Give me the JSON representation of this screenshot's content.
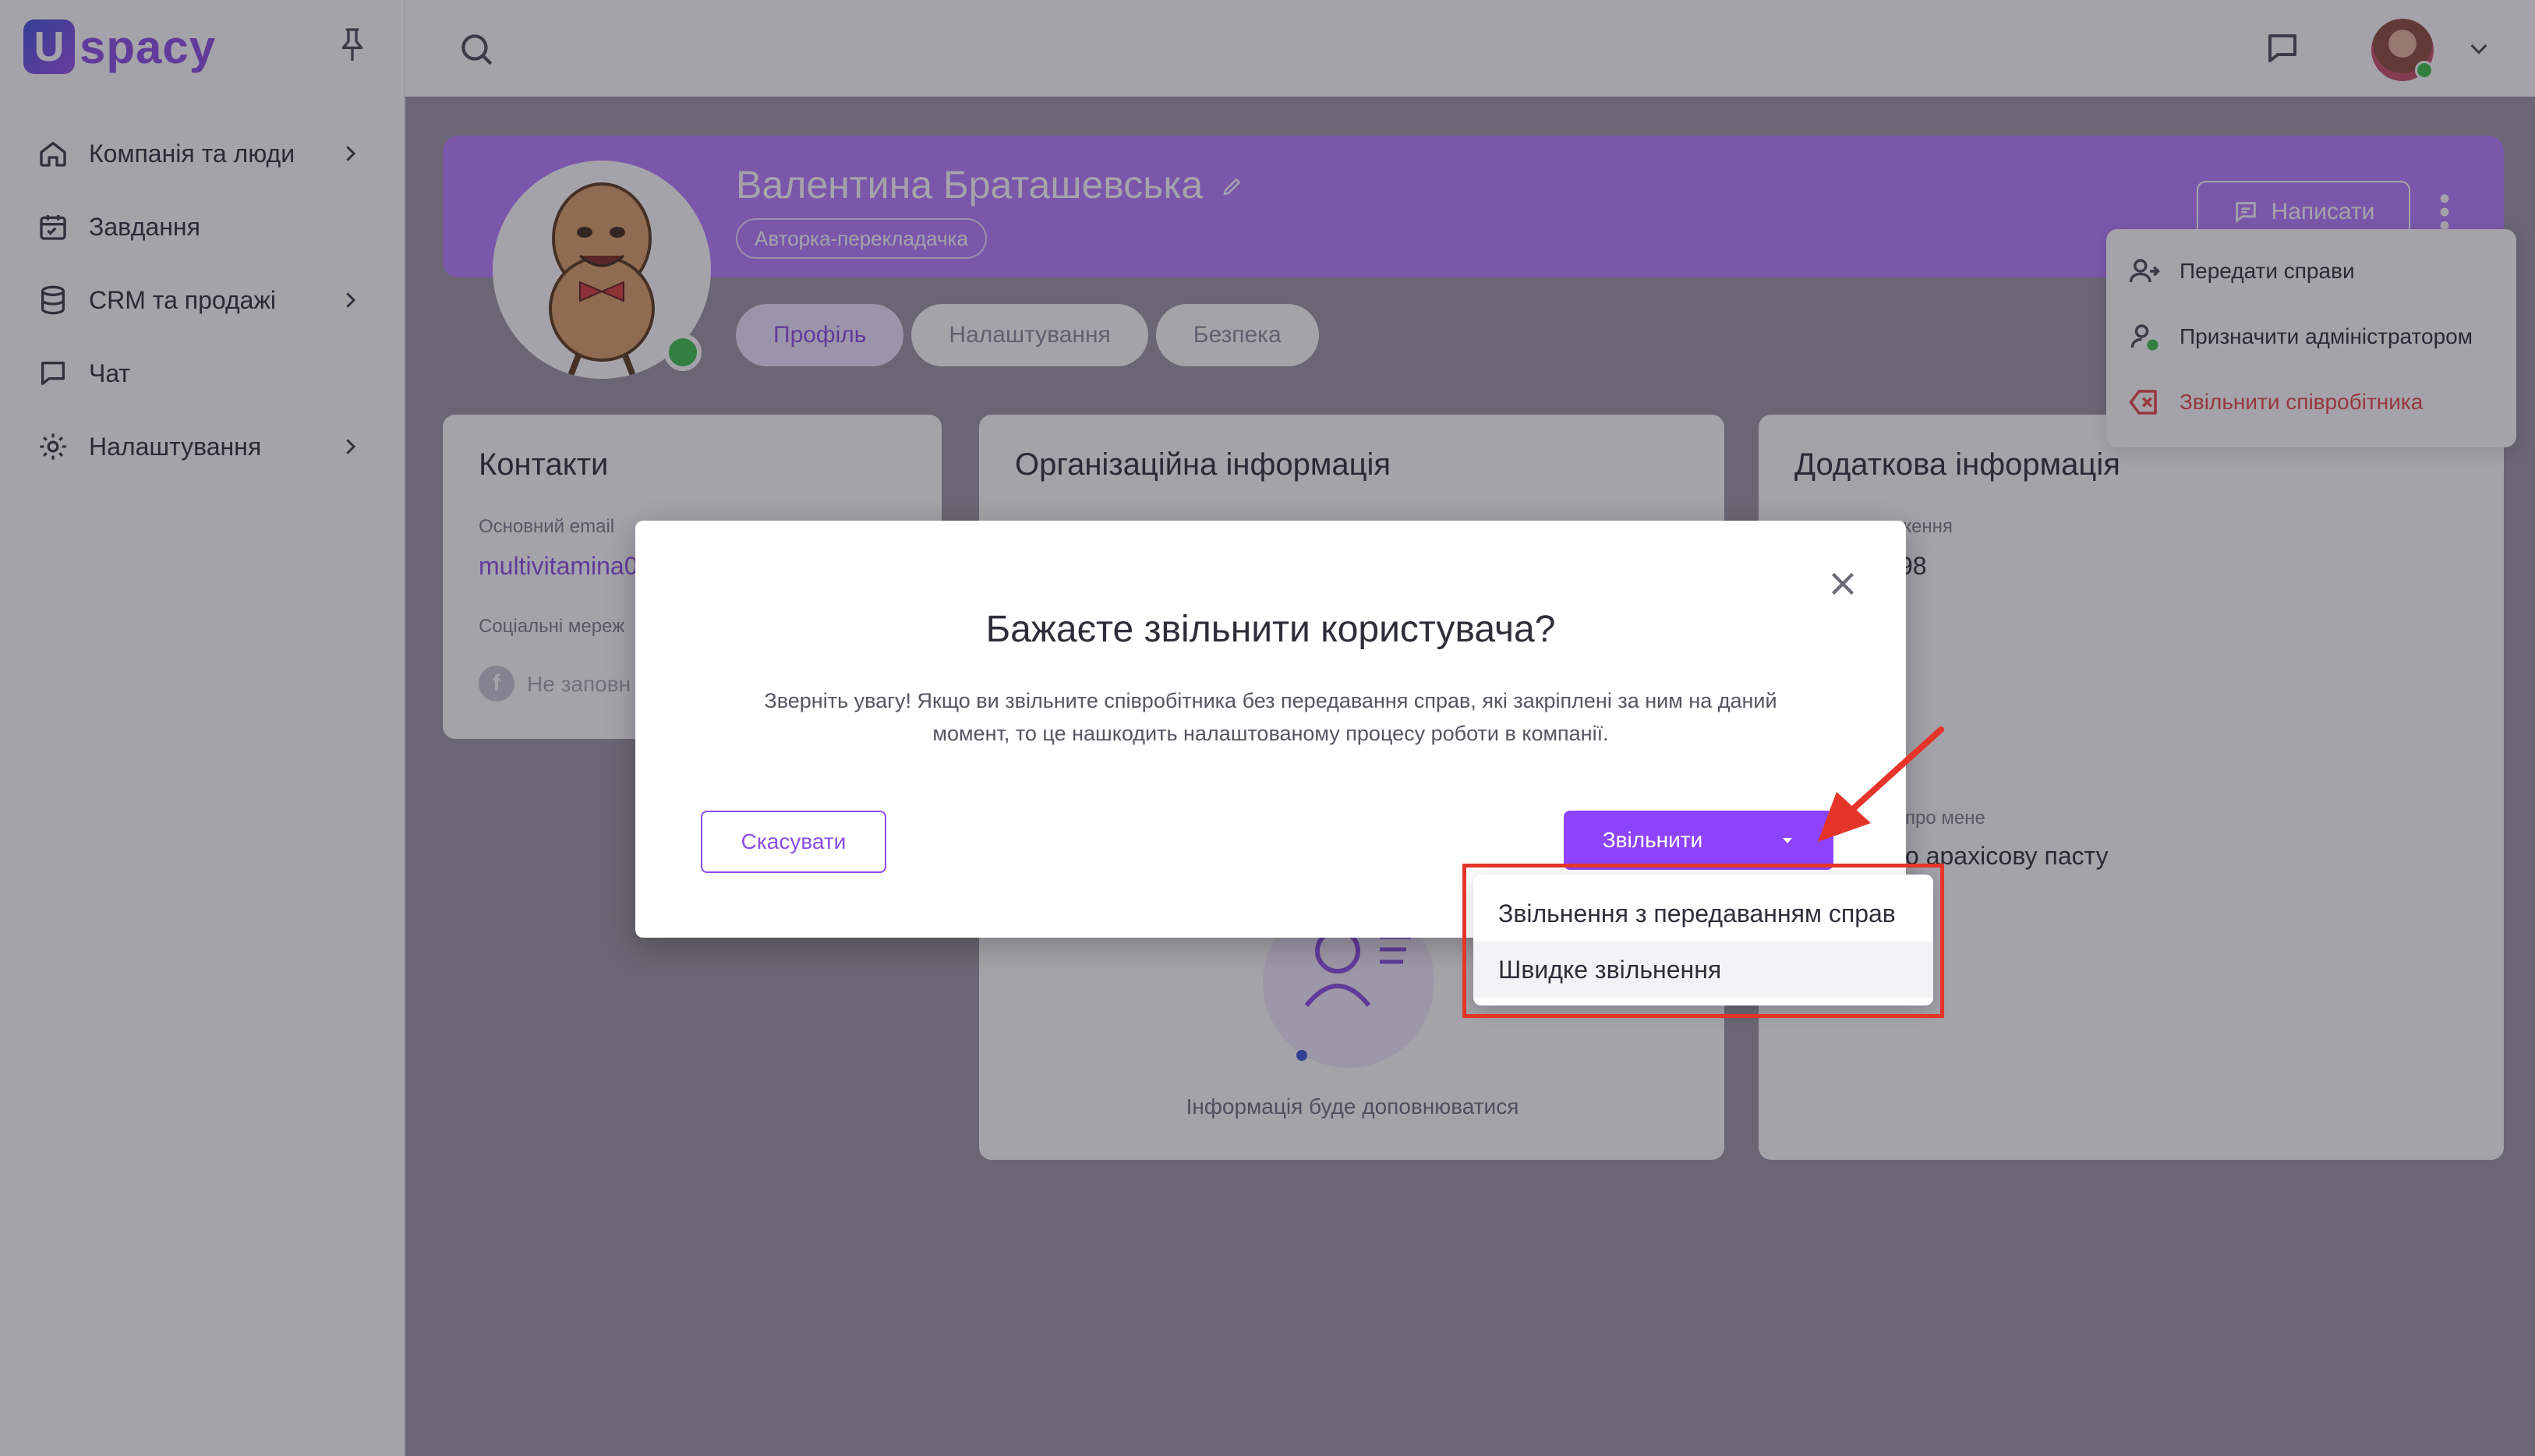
{
  "app": {
    "logo_text": "spacy",
    "logo_letter": "U"
  },
  "sidebar": {
    "items": [
      {
        "label": "Компанія та люди",
        "icon": "home-icon",
        "has_submenu": true
      },
      {
        "label": "Завдання",
        "icon": "calendar-icon",
        "has_submenu": false
      },
      {
        "label": "CRM та продажі",
        "icon": "database-icon",
        "has_submenu": true
      },
      {
        "label": "Чат",
        "icon": "chat-icon",
        "has_submenu": false
      },
      {
        "label": "Налаштування",
        "icon": "gear-icon",
        "has_submenu": true
      }
    ]
  },
  "profile": {
    "name": "Валентина Браташевська",
    "role": "Авторка-перекладачка",
    "write_button": "Написати",
    "tabs": [
      "Профіль",
      "Налаштування",
      "Безпека"
    ],
    "active_tab": 0
  },
  "actions_menu": {
    "items": [
      {
        "label": "Передати справи",
        "icon": "users-transfer-icon",
        "danger": false
      },
      {
        "label": "Призначити адміністратором",
        "icon": "user-admin-icon",
        "danger": false
      },
      {
        "label": "Звільнити співробітника",
        "icon": "close-box-icon",
        "danger": true
      }
    ]
  },
  "cards": {
    "contacts": {
      "title": "Контакти",
      "email_label": "Основний email",
      "email_value": "multivitamina0",
      "social_label": "Соціальні мереж",
      "social_value": "Не заповн"
    },
    "org": {
      "title": "Організаційна інформація",
      "note": "Інформація буде доповнюватися"
    },
    "extra": {
      "title": "Додаткова інформація",
      "birth_label": "ження",
      "birth_value": "98",
      "about_label": "про мене",
      "about_value": "о арахісову пасту"
    }
  },
  "modal": {
    "title": "Бажаєте звільнити користувача?",
    "text": "Зверніть увагу! Якщо ви звільните співробітника без передавання справ, які закріплені за ним на даний момент, то це нашкодить налаштованому процесу роботи в компанії.",
    "cancel_label": "Скасувати",
    "confirm_label": "Звільнити",
    "split_options": [
      "Звільнення з передаванням справ",
      "Швидке звільнення"
    ],
    "hovered_option": 1
  },
  "colors": {
    "accent": "#8e44ff",
    "banner": "#b57cff",
    "danger": "#e84545",
    "annotation": "#e5352b",
    "online": "#3cbf4b"
  }
}
